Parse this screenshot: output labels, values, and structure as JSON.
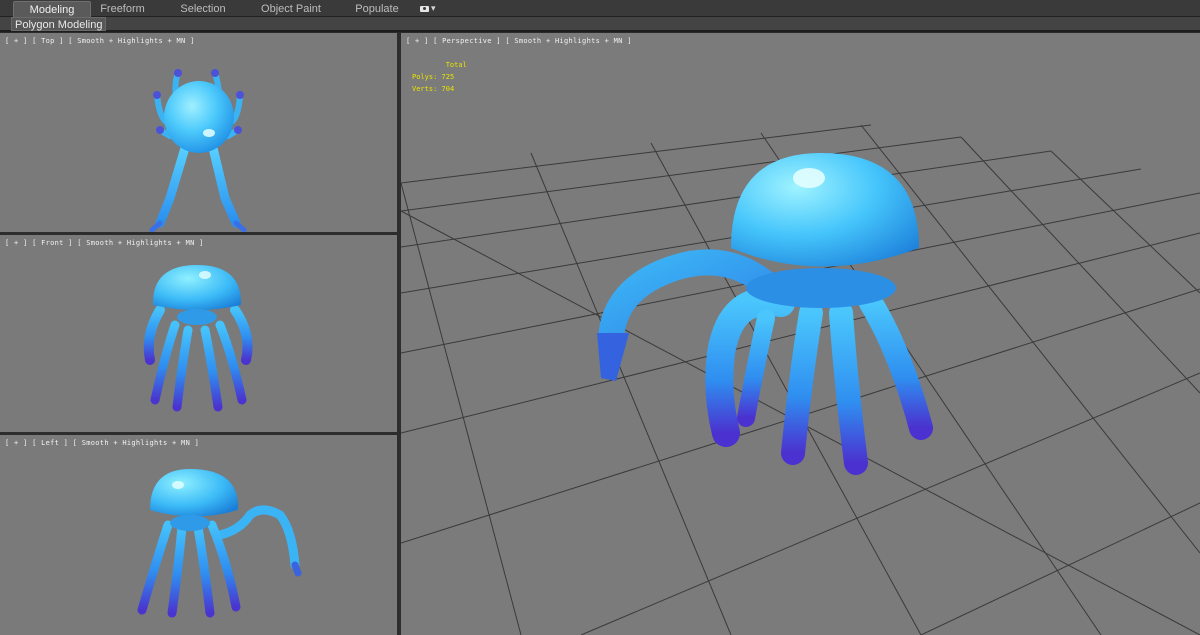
{
  "ribbon": {
    "tabs": [
      "Modeling",
      "Freeform",
      "Selection",
      "Object Paint",
      "Populate"
    ],
    "active_tab": "Modeling",
    "panel_title": "Polygon Modeling",
    "options_icon": "camera-dropdown-icon"
  },
  "viewports": {
    "top": {
      "label": "[ + ] [ Top ] [ Smooth + Highlights + MN ]"
    },
    "front": {
      "label": "[ + ] [ Front ] [ Smooth + Highlights + MN ]"
    },
    "left": {
      "label": "[ + ] [ Left ] [ Smooth + Highlights + MN ]"
    },
    "perspective": {
      "label": "[ + ] [ Perspective ] [ Smooth + Highlights + MN ]",
      "stats": {
        "header": "Total",
        "polys_label": "Polys:",
        "polys_value": "725",
        "verts_label": "Verts:",
        "verts_value": "704"
      }
    }
  },
  "colors": {
    "viewport_bg": "#7a7a7a",
    "grid_line": "#2a2a2a",
    "stats_text": "#e8e400",
    "jelly_light": "#5fd8ff",
    "jelly_mid": "#2aa8f0",
    "jelly_dark": "#4b3fd6"
  }
}
